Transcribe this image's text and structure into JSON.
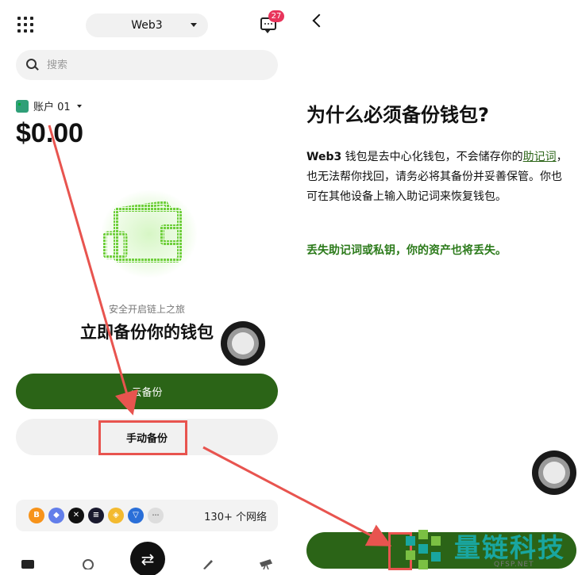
{
  "left": {
    "top_bar": {
      "network_selector": "Web3",
      "message_count": "27"
    },
    "search": {
      "placeholder": "搜索"
    },
    "account": {
      "name": "账户 01",
      "balance": "$0.00"
    },
    "empty_state": {
      "subtitle": "安全开启链上之旅",
      "title": "立即备份你的钱包"
    },
    "buttons": {
      "cloud_backup": "云备份",
      "manual_backup": "手动备份"
    },
    "networks": {
      "label": "130+ 个网络",
      "chains": [
        {
          "name": "bitcoin-icon",
          "color": "#f7931a",
          "glyph": "B"
        },
        {
          "name": "ethereum-icon",
          "color": "#627eea",
          "glyph": "◆"
        },
        {
          "name": "okx-icon",
          "color": "#111111",
          "glyph": "✕"
        },
        {
          "name": "solana-icon",
          "color": "#1a1a2e",
          "glyph": "≡"
        },
        {
          "name": "bnb-icon",
          "color": "#f3ba2f",
          "glyph": "◈"
        },
        {
          "name": "tron-icon",
          "color": "#2a6fd8",
          "glyph": "▽"
        },
        {
          "name": "more-icon",
          "color": "#dddddd",
          "glyph": "···"
        }
      ]
    },
    "tabbar": {
      "swap_glyph": "⇄"
    }
  },
  "right": {
    "title": "为什么必须备份钱包?",
    "body": {
      "brand": "Web3",
      "part1": " 钱包是去中心化钱包，不会储存你的",
      "link": "助记词",
      "part2": "，也无法帮你找回，请务必将其备份并妥善保管。你也可在其他设备上输入助记词来恢复钱包。"
    },
    "warning": "丢失助记词或私钥，你的资产也将丢失。"
  },
  "watermark": {
    "text": "量链科技",
    "sub": "QFSP.NET"
  },
  "colors": {
    "primary_green": "#2b6417",
    "warning_green": "#2b7a1a",
    "highlight_red": "#e8544f",
    "badge_pink": "#e8345b",
    "watermark_teal": "#19a6a0"
  }
}
